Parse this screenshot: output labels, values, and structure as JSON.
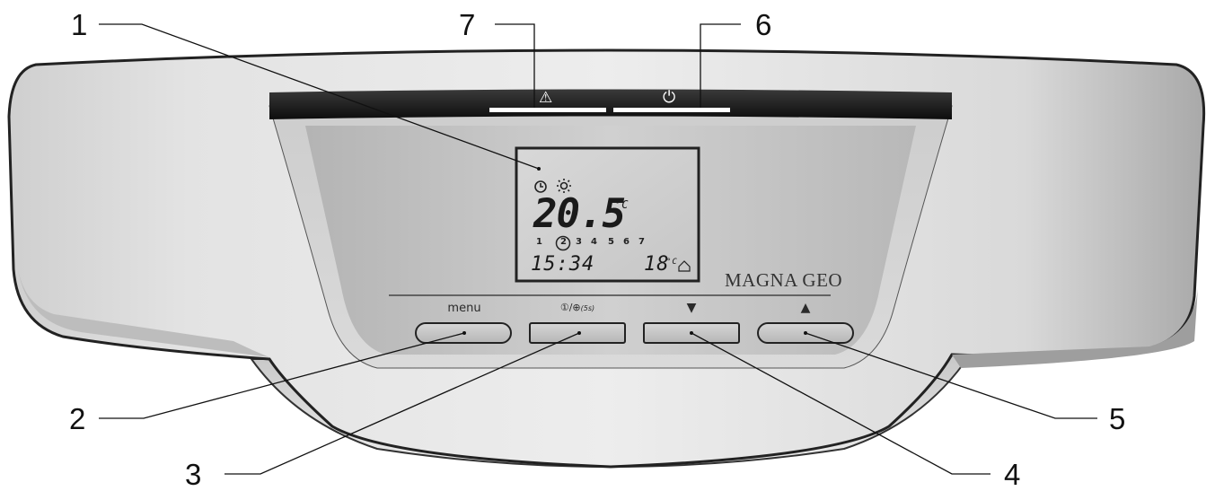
{
  "callouts": [
    "1",
    "2",
    "3",
    "4",
    "5",
    "6",
    "7"
  ],
  "status_bar": {
    "alarm_symbol": "⚠",
    "power_symbol": "⏻"
  },
  "display": {
    "clock_icon": "clock-icon",
    "sun_icon": "sun-icon",
    "temperature": "20.5",
    "temperature_unit": "°C",
    "days": [
      "1",
      "2",
      "3",
      "4",
      "5",
      "6",
      "7"
    ],
    "selected_day": "2",
    "time": "15:34",
    "setback_temperature": "18",
    "setback_unit": "°C"
  },
  "brand": "MAGNA GEO",
  "buttons": {
    "menu_label": "menu",
    "info_label_a": "①/",
    "info_label_b": "⊕",
    "info_label_c": "(5s)",
    "down_symbol": "▼",
    "up_symbol": "▲"
  }
}
